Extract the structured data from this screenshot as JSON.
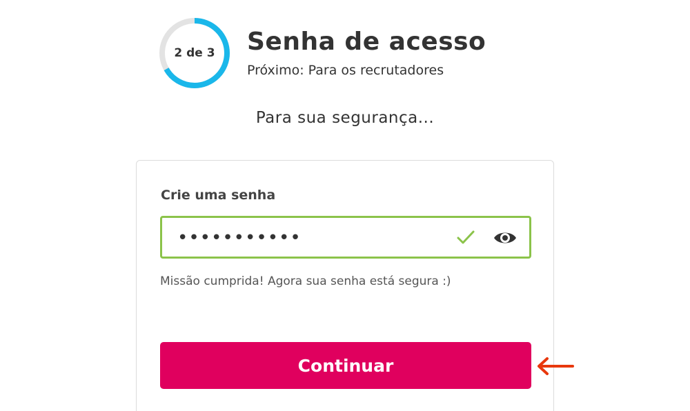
{
  "progress": {
    "label": "2 de 3",
    "current_step": 2,
    "total_steps": 3,
    "fraction": 0.667,
    "ring_color": "#1ab7ea",
    "track_color": "#e3e3e3"
  },
  "header": {
    "title": "Senha de acesso",
    "next": "Próximo: Para os recrutadores"
  },
  "security_heading": "Para sua segurança...",
  "form": {
    "password_label": "Crie uma senha",
    "password_value": "•••••••••••",
    "valid_icon": "check-icon",
    "toggle_icon": "eye-icon",
    "helper_text": "Missão cumprida! Agora sua senha está segura :)",
    "valid_color": "#8bc34a"
  },
  "continue_label": "Continuar",
  "colors": {
    "accent": "#e0005e",
    "annotation_arrow": "#e8380d"
  },
  "annotation": {
    "icon": "left-arrow-icon"
  }
}
